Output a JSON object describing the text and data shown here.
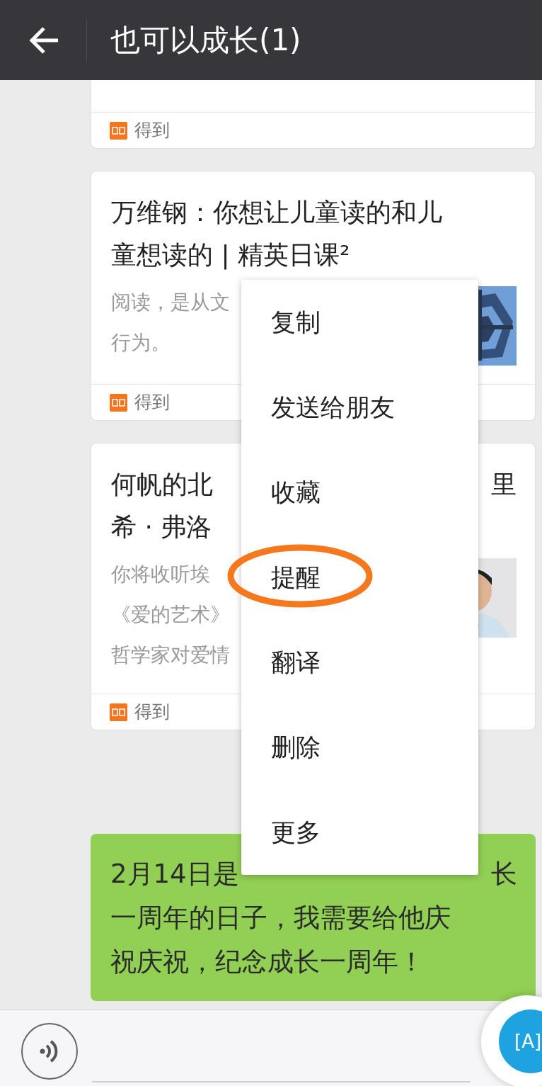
{
  "header": {
    "title": "也可以成长(1)"
  },
  "messages": [
    {
      "kind": "article",
      "source": "得到"
    },
    {
      "kind": "article",
      "title_lines": [
        "万维钢：你想让儿童读的和儿",
        "童想读的 | 精英日课²"
      ],
      "desc_lines": [
        "阅读，是从文",
        "行为。"
      ],
      "source": "得到"
    },
    {
      "kind": "article",
      "title_lines": [
        "何帆的北",
        "希 · 弗洛"
      ],
      "title_tail": "里",
      "desc_lines": [
        "你将收听埃",
        "《爱的艺术》",
        "哲学家对爱情"
      ],
      "source": "得到"
    },
    {
      "kind": "text",
      "lines": [
        "2月14日是",
        "一周年的日子，我需要给他庆",
        "祝庆祝，纪念成长一周年！"
      ],
      "tail": "长"
    }
  ],
  "context_menu": [
    {
      "label": "复制",
      "circled": false
    },
    {
      "label": "发送给朋友",
      "circled": false
    },
    {
      "label": "收藏",
      "circled": false
    },
    {
      "label": "提醒",
      "circled": true
    },
    {
      "label": "翻译",
      "circled": false
    },
    {
      "label": "删除",
      "circled": false
    },
    {
      "label": "更多",
      "circled": false
    }
  ],
  "floating_button": {
    "label": "[A]"
  }
}
